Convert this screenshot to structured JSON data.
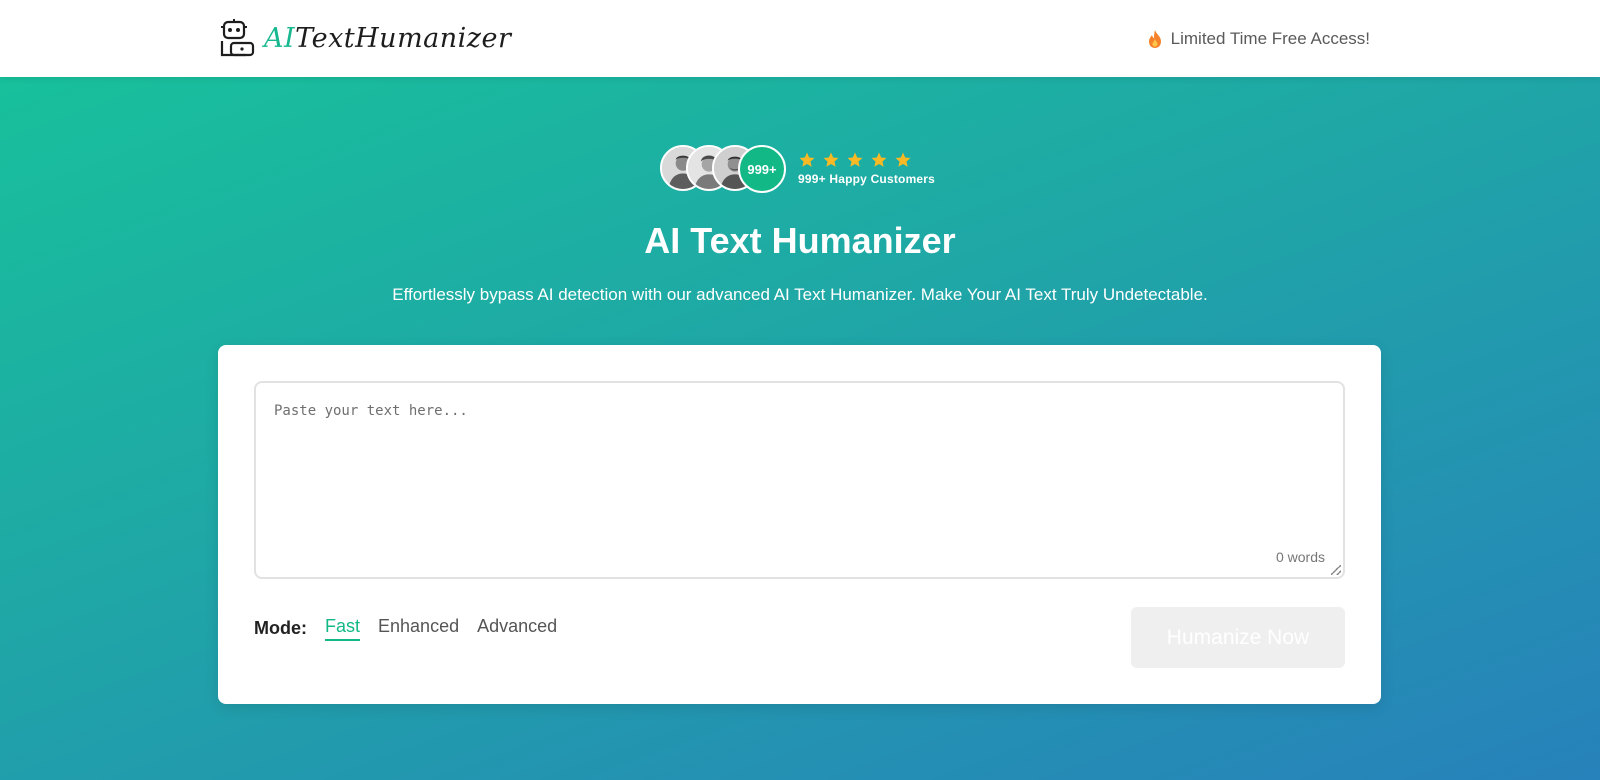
{
  "header": {
    "logo": {
      "ai": "AI",
      "rest": "TextHumanizer"
    },
    "promo": {
      "icon": "flame-icon",
      "text": "Limited Time Free Access!"
    }
  },
  "social_proof": {
    "avatar_count": "999+",
    "stars": 5,
    "customers": "999+ Happy Customers"
  },
  "hero": {
    "title": "AI Text Humanizer",
    "subtitle": "Effortlessly bypass AI detection with our advanced AI Text Humanizer. Make Your AI Text Truly Undetectable."
  },
  "editor": {
    "value": "",
    "placeholder": "Paste your text here...",
    "word_count": "0 words"
  },
  "modes": {
    "label": "Mode:",
    "options": [
      "Fast",
      "Enhanced",
      "Advanced"
    ],
    "selected": "Fast"
  },
  "actions": {
    "humanize_label": "Humanize Now",
    "humanize_disabled": true
  },
  "colors": {
    "accent": "#12b886",
    "gradient_start": "#17c49a",
    "gradient_end": "#2781bb",
    "star": "#f7b924",
    "flame": "#f5822a"
  }
}
